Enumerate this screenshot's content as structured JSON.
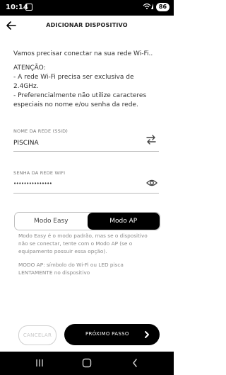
{
  "status_bar": {
    "time": "10:14",
    "battery": "86",
    "icons": [
      "screenshot-icon",
      "wifi-icon",
      "signal-icon",
      "battery-icon"
    ]
  },
  "header": {
    "title": "ADICIONAR DISPOSITIVO",
    "back_icon": "arrow-left-icon"
  },
  "intro": {
    "line1": "Vamos precisar conectar na sua rede Wi-Fi..",
    "attention_title": "ATENÇÃO:",
    "bullet1_line1": "- A rede Wi-Fi precisa ser exclusiva de",
    "bullet1_line2": "2.4GHz.",
    "bullet2_line1": "- Preferencialmente não utilize caracteres",
    "bullet2_line2": "especiais no nome e/ou senha da rede."
  },
  "network": {
    "label": "NOME DA REDE (SSID)",
    "value": "PISCINA",
    "swap_icon": "swap-arrows-icon"
  },
  "password": {
    "label": "SENHA DA REDE WIFI",
    "value": "•••••••••••••••",
    "eye_icon": "eye-icon"
  },
  "mode": {
    "option_easy": "Modo Easy",
    "option_ap": "Modo AP",
    "selected": "Modo AP"
  },
  "notes": {
    "easy_1": "Modo Easy é o modo padrão, mas se o dispositivo",
    "easy_2": "não se conectar, tente com o Modo AP (se o",
    "easy_3": "equipamento possuir essa opção).",
    "ap_1": "MODO AP: símbolo do Wi-Fi ou LED pisca",
    "ap_2": "LENTAMENTE no dispositivo"
  },
  "actions": {
    "cancel": "CANCELAR",
    "next": "PRÓXIMO PASSO"
  },
  "colors": {
    "primary": "#000000",
    "background": "#ffffff",
    "muted": "#8a8a8a"
  }
}
